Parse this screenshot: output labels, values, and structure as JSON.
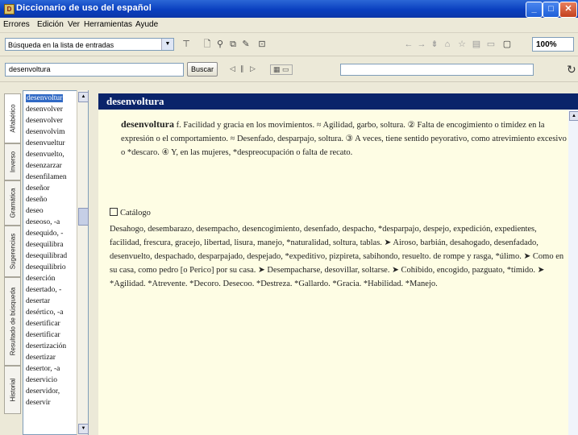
{
  "window": {
    "title": "Diccionario de uso del español"
  },
  "menu": [
    "Errores",
    "Edición",
    "Ver",
    "Herramientas",
    "Ayude"
  ],
  "toolbar1": {
    "search_mode": "Búsqueda en la lista de entradas",
    "zoom": "100%"
  },
  "toolbar2": {
    "search_value": "desenvoltura",
    "search_button": "Buscar"
  },
  "tabs": [
    "Alfabético",
    "Inverso",
    "Gramática",
    "Sugerencias",
    "Resultado de búsqueda",
    "Historial"
  ],
  "wordlist": {
    "items": [
      "desenvoltur",
      "desenvolver",
      "desenvolver",
      "desenvolvim",
      "desenvueltur",
      "desenvuelto,",
      "desenzarzar",
      "desenfilamen",
      "deseñor",
      "deseño",
      "deseo",
      "deseoso, -a",
      "desequido, -",
      "desequilibra",
      "desequilibrad",
      "desequilibrio",
      "deserción",
      "desertado, -",
      "desertar",
      "desértico, -a",
      "desertificar",
      "desertificar",
      "desertización",
      "desertizar",
      "desertor, -a",
      "deservicio",
      "deservidor,",
      "deservir"
    ]
  },
  "content": {
    "headword": "desenvoltura",
    "definition_head": "desenvoltura",
    "definition_body": "f. Facilidad y gracia en los movimientos. ≈ Agilidad, garbo, soltura. ② Falta de encogimiento o timidez en la expresión o el comportamiento. ≈ Desenfado, desparpajo, soltura. ③ A veces, tiene sentido peyorativo, como atrevimiento excesivo o *descaro. ④ Y, en las mujeres, *despreocupación o falta de recato.",
    "catalog_title": "Catálogo",
    "catalog_body": "Desahogo, desembarazo, desempacho, desencogimiento, desenfado, despacho, *desparpajo, despejo, expedición, expedientes, facilidad, frescura, gracejo, libertad, lisura, manejo, *naturalidad, soltura, tablas. ➤ Airoso, barbián, desahogado, desenfadado, desenvuelto, despachado, desparpajado, despejado, *expeditivo, pizpireta, sabihondo, resuelto. de rompe y rasga, *úlimo. ➤ Como en su casa, como pedro [o Perico] por su casa. ➤ Desempacharse, desovillar, soltarse. ➤ Cohibido, encogido, pazguato, *tímido. ➤ *Agilidad. *Atrevente. *Decoro. Desecoo. *Destreza. *Gallardo. *Gracia. *Habilidad. *Manejo."
  }
}
